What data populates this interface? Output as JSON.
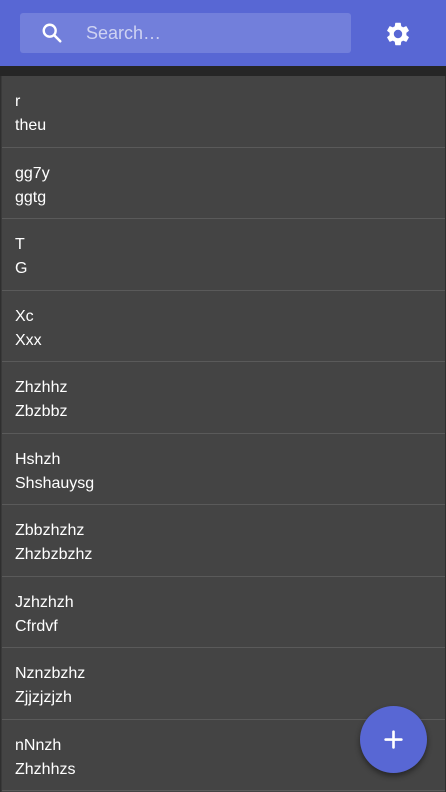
{
  "header": {
    "search": {
      "placeholder": "Search…",
      "value": "",
      "icon": "search-icon"
    },
    "settings_icon": "gear-icon"
  },
  "list": {
    "items": [
      {
        "title": "r",
        "subtitle": "theu"
      },
      {
        "title": "gg7y",
        "subtitle": "ggtg"
      },
      {
        "title": "T",
        "subtitle": "G"
      },
      {
        "title": "Xc",
        "subtitle": "Xxx"
      },
      {
        "title": "Zhzhhz",
        "subtitle": "Zbzbbz"
      },
      {
        "title": "Hshzh",
        "subtitle": "Shshauysg"
      },
      {
        "title": "Zbbzhzhz",
        "subtitle": "Zhzbzbzhz"
      },
      {
        "title": "Jzhzhzh",
        "subtitle": "Cfrdvf"
      },
      {
        "title": "Nznzbzhz",
        "subtitle": "Zjjzjzjzh"
      },
      {
        "title": "nNnzh",
        "subtitle": "Zhzhhzs"
      }
    ]
  },
  "fab": {
    "icon": "plus-icon"
  },
  "colors": {
    "primary": "#5867d4",
    "list_background": "#444444",
    "divider": "#5a5a5a",
    "text": "#ffffff"
  }
}
